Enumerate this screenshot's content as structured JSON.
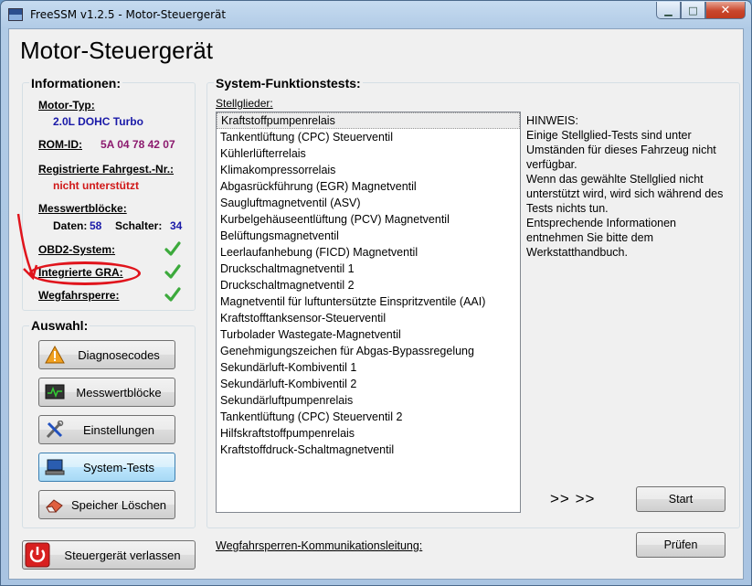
{
  "window": {
    "title": "FreeSSM v1.2.5 - Motor-Steuergerät",
    "controls": {
      "minimize": "▁",
      "maximize": "□",
      "close": "✕"
    }
  },
  "page": {
    "title": "Motor-Steuergerät"
  },
  "info": {
    "heading": "Informationen:",
    "motor_type_label": "Motor-Typ:",
    "motor_type_value": "2.0L DOHC Turbo",
    "rom_id_label": "ROM-ID:",
    "rom_id_value": "5A 04 78 42 07",
    "vin_label": "Registrierte Fahrgest.-Nr.:",
    "vin_value": "nicht unterstützt",
    "blocks_label": "Messwertblöcke:",
    "data_label": "Daten:",
    "data_count": "58",
    "switch_label": "Schalter:",
    "switch_count": "34",
    "obd2_label": "OBD2-System:",
    "gra_label": "Integrierte GRA:",
    "immo_label": "Wegfahrsperre:"
  },
  "selection": {
    "heading": "Auswahl:",
    "buttons": [
      {
        "label": "Diagnosecodes",
        "icon": "warning-icon"
      },
      {
        "label": "Messwertblöcke",
        "icon": "monitor-icon"
      },
      {
        "label": "Einstellungen",
        "icon": "tools-icon"
      },
      {
        "label": "System-Tests",
        "icon": "laptop-icon"
      },
      {
        "label": "Speicher Löschen",
        "icon": "eraser-icon"
      }
    ],
    "exit_button": "Steuergerät verlassen"
  },
  "tests": {
    "heading": "System-Funktionstests:",
    "actuators_label": "Stellglieder:",
    "items": [
      "Kraftstoffpumpenrelais",
      "Tankentlüftung (CPC) Steuerventil",
      "Kühlerlüfterrelais",
      "Klimakompressorrelais",
      "Abgasrückführung (EGR) Magnetventil",
      "Saugluftmagnetventil (ASV)",
      "Kurbelgehäuseentlüftung (PCV) Magnetventil",
      "Belüftungsmagnetventil",
      "Leerlaufanhebung (FICD) Magnetventil",
      "Druckschaltmagnetventil 1",
      "Druckschaltmagnetventil 2",
      "Magnetventil für luftuntersützte Einspritzventile (AAI)",
      "Kraftstofftanksensor-Steuerventil",
      "Turbolader Wastegate-Magnetventil",
      "Genehmigungszeichen für Abgas-Bypassregelung",
      "Sekundärluft-Kombiventil 1",
      "Sekundärluft-Kombiventil 2",
      "Sekundärluftpumpenrelais",
      "Tankentlüftung (CPC) Steuerventil 2",
      "Hilfskraftstoffpumpenrelais",
      "Kraftstoffdruck-Schaltmagnetventil"
    ],
    "note_lines": [
      "HINWEIS:",
      "Einige Stellglied-Tests sind unter",
      "Umständen für dieses Fahrzeug nicht",
      "verfügbar.",
      "Wenn das gewählte Stellglied nicht",
      "unterstützt wird, wird sich während des",
      "Tests nichts tun.",
      "Entsprechende Informationen",
      "entnehmen Sie bitte dem",
      "Werkstatthandbuch."
    ],
    "arrows": ">> >>",
    "start_button": "Start",
    "immo_line_label": "Wegfahrsperren-Kommunikationsleitung:",
    "check_button": "Prüfen"
  },
  "colors": {
    "accent_blue": "#1a1aa8",
    "rom_purple": "#8c1a6e",
    "warning_red": "#d01818",
    "check_green": "#3caa3c",
    "annotation_red": "#e0141c"
  }
}
